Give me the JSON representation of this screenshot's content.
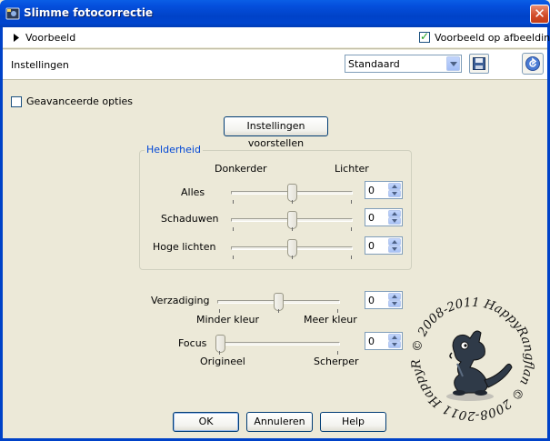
{
  "window": {
    "title": "Slimme fotocorrectie",
    "close_symbol": "✕"
  },
  "preview": {
    "toggle_label": "Voorbeeld",
    "on_image_label": "Voorbeeld op afbeelding",
    "on_image_checked": true
  },
  "settings": {
    "label": "Instellingen",
    "preset_value": "Standaard"
  },
  "advanced": {
    "label": "Geavanceerde opties",
    "checked": false
  },
  "suggest_button": "Instellingen voorstellen",
  "brightness": {
    "group_title": "Helderheid",
    "left_caption": "Donkerder",
    "right_caption": "Lichter",
    "rows": [
      {
        "label": "Alles",
        "value": "0"
      },
      {
        "label": "Schaduwen",
        "value": "0"
      },
      {
        "label": "Hoge lichten",
        "value": "0"
      }
    ]
  },
  "saturation": {
    "label": "Verzadiging",
    "value": "0",
    "left_caption": "Minder kleur",
    "right_caption": "Meer kleur"
  },
  "focus": {
    "label": "Focus",
    "value": "0",
    "left_caption": "Origineel",
    "right_caption": "Scherper"
  },
  "watermark": {
    "text": "© 2008-2011  HappyRangflan  © 2008-2011  HappyRangflan"
  },
  "buttons": {
    "ok": "OK",
    "cancel": "Annuleren",
    "help": "Help"
  }
}
